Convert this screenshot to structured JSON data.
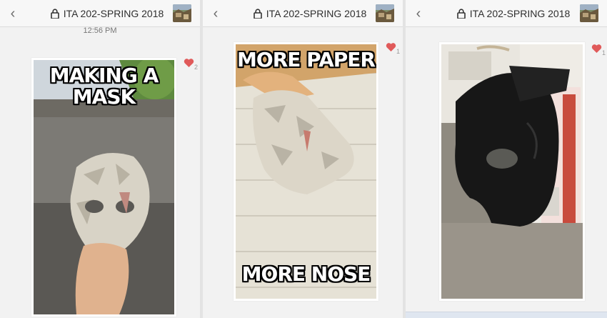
{
  "panels": [
    {
      "title": "ITA 202-SPRING 2018",
      "timestamp": "12:56 PM",
      "like_count": "2",
      "caption_top": "MAKING A\nMASK",
      "caption_bottom": ""
    },
    {
      "title": "ITA 202-SPRING 2018",
      "timestamp": "",
      "like_count": "1",
      "caption_top": "MORE PAPER",
      "caption_bottom": "MORE NOSE"
    },
    {
      "title": "ITA 202-SPRING 2018",
      "timestamp": "",
      "like_count": "1",
      "caption_top": "",
      "caption_bottom": ""
    }
  ],
  "icons": {
    "back": "chevron-left-icon",
    "lock": "lock-icon",
    "heart": "heart-icon"
  },
  "colors": {
    "heart": "#e05a5a",
    "header_bg": "#f7f7f7",
    "panel_bg": "#f2f2f2"
  }
}
